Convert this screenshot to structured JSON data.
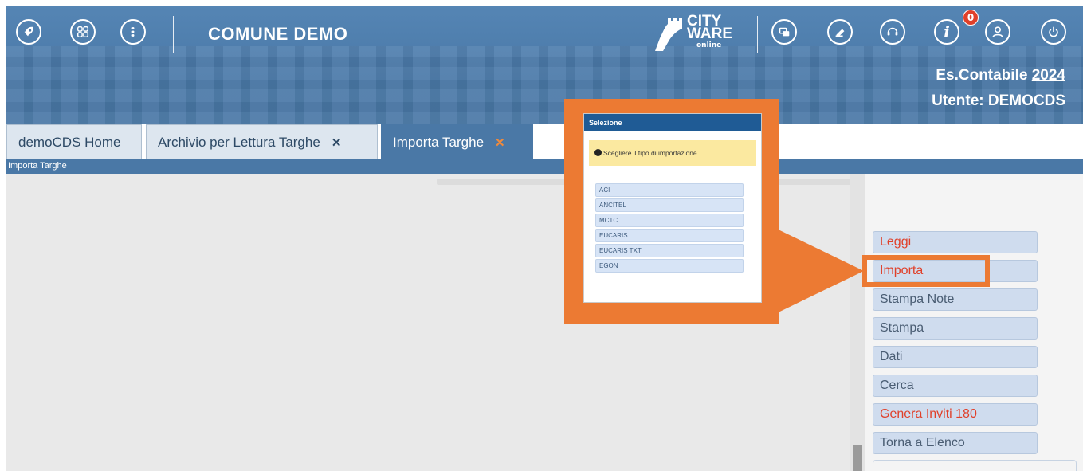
{
  "header": {
    "title": "COMUNE DEMO",
    "logo": {
      "line1": "CITY",
      "line2": "WARE",
      "line3": "online"
    },
    "notification_count": "0",
    "fiscal_year_label": "Es.Contabile",
    "fiscal_year": "2024",
    "user_label": "Utente: DEMOCDS",
    "left_icons": [
      "rocket-icon",
      "apps-grid-icon",
      "more-vertical-icon"
    ],
    "right_icons": [
      "windows-icon",
      "stamp-icon",
      "headset-icon",
      "info-icon",
      "user-icon",
      "power-icon"
    ]
  },
  "tabs": [
    {
      "label": "demoCDS Home",
      "closable": false
    },
    {
      "label": "Archivio per Lettura Targhe",
      "closable": true
    },
    {
      "label": "Importa Targhe",
      "closable": true,
      "active": true
    }
  ],
  "tab_close_glyph": "✕",
  "breadcrumb": "Importa Targhe",
  "side_buttons": [
    {
      "label": "Leggi",
      "highlighted": true
    },
    {
      "label": "Importa",
      "highlighted": true
    },
    {
      "label": "Stampa Note",
      "highlighted": false
    },
    {
      "label": "Stampa",
      "highlighted": false
    },
    {
      "label": "Dati",
      "highlighted": false
    },
    {
      "label": "Cerca",
      "highlighted": false
    },
    {
      "label": "Genera Inviti 180",
      "highlighted": true
    },
    {
      "label": "Torna a Elenco",
      "highlighted": false
    }
  ],
  "popup": {
    "title": "Selezione",
    "message": "Scegliere il tipo di importazione",
    "options": [
      "ACI",
      "ANCITEL",
      "MCTC",
      "EUCARIS",
      "EUCARIS TXT",
      "EGON"
    ]
  },
  "colors": {
    "header_blue": "#4a78a6",
    "accent_orange": "#ec7a33",
    "badge_red": "#e0402a",
    "popup_title_blue": "#1f5b95",
    "warning_yellow": "#fbe9a0"
  }
}
